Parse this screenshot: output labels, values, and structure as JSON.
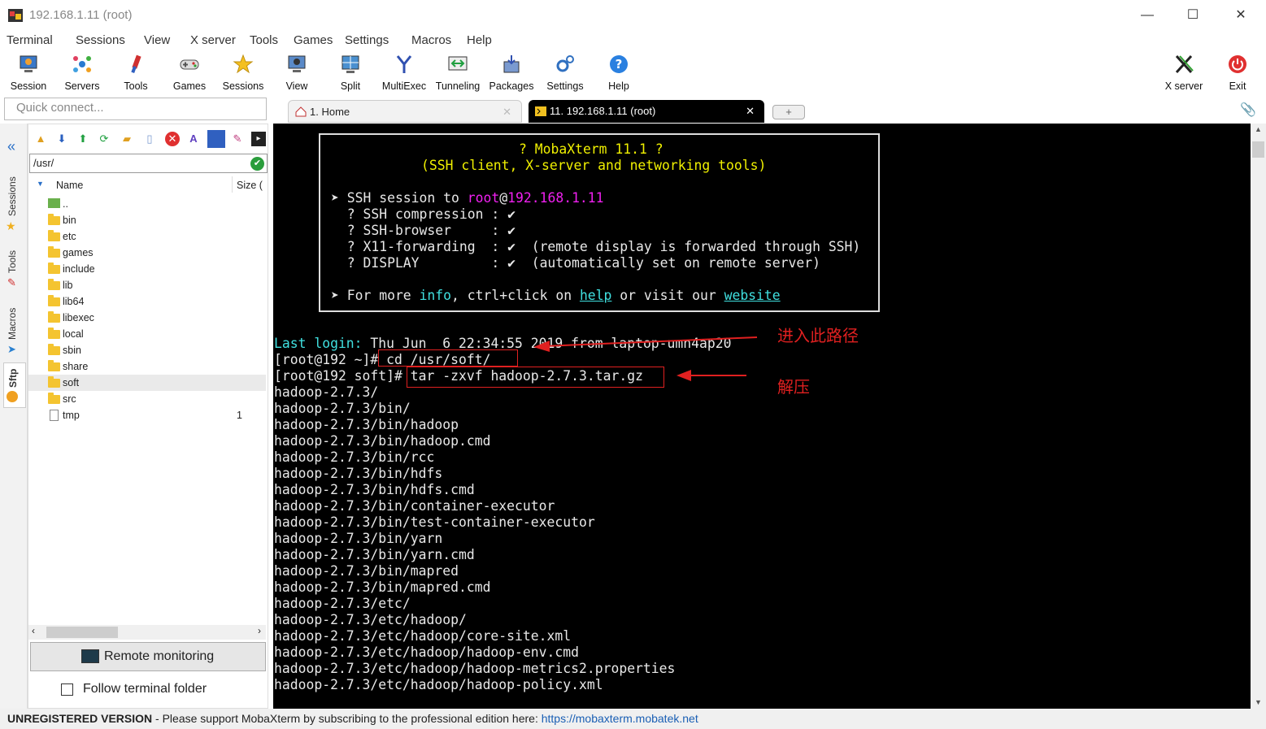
{
  "window": {
    "title": "192.168.1.11 (root)",
    "minimize": "—",
    "maximize": "☐",
    "close": "✕"
  },
  "menu": [
    "Terminal",
    "Sessions",
    "View",
    "X server",
    "Tools",
    "Games",
    "Settings",
    "Macros",
    "Help"
  ],
  "toolbar": {
    "session": "Session",
    "servers": "Servers",
    "tools": "Tools",
    "games": "Games",
    "sessions": "Sessions",
    "view": "View",
    "split": "Split",
    "multiexec": "MultiExec",
    "tunneling": "Tunneling",
    "packages": "Packages",
    "settings": "Settings",
    "help": "Help",
    "xserver": "X server",
    "exit": "Exit"
  },
  "quick_connect": {
    "placeholder": "Quick connect..."
  },
  "tabs": {
    "home": "1. Home",
    "ssh": "11. 192.168.1.11 (root)",
    "close": "✕",
    "add": "+"
  },
  "side_tabs": {
    "sessions": "Sessions",
    "tools": "Tools",
    "macros": "Macros",
    "sftp": "Sftp"
  },
  "sftp": {
    "path": "/usr/",
    "col_name": "Name",
    "col_size": "Size (",
    "files": [
      {
        "name": "..",
        "size": ""
      },
      {
        "name": "bin",
        "size": ""
      },
      {
        "name": "etc",
        "size": ""
      },
      {
        "name": "games",
        "size": ""
      },
      {
        "name": "include",
        "size": ""
      },
      {
        "name": "lib",
        "size": ""
      },
      {
        "name": "lib64",
        "size": ""
      },
      {
        "name": "libexec",
        "size": ""
      },
      {
        "name": "local",
        "size": ""
      },
      {
        "name": "sbin",
        "size": ""
      },
      {
        "name": "share",
        "size": ""
      },
      {
        "name": "soft",
        "size": ""
      },
      {
        "name": "src",
        "size": ""
      },
      {
        "name": "tmp",
        "size": "1"
      }
    ],
    "remote_monitoring": "Remote monitoring",
    "follow_folder": "Follow terminal folder"
  },
  "terminal": {
    "banner": {
      "title": "? MobaXterm 11.1 ?",
      "subtitle": "(SSH client, X-server and networking tools)",
      "ssh_prefix": "➤ SSH session to ",
      "user": "root",
      "at": "@",
      "host": "192.168.1.11",
      "compression": "  ? SSH compression : ✔",
      "browser": "  ? SSH-browser     : ✔",
      "x11": "  ? X11-forwarding  : ✔  (remote display is forwarded through SSH)",
      "display": "  ? DISPLAY         : ✔  (automatically set on remote server)",
      "more_prefix": "➤ For more ",
      "info": "info",
      "more_mid": ", ctrl+click on ",
      "help": "help",
      "more_mid2": " or visit our ",
      "website": "website"
    },
    "last_login_label": "Last login:",
    "last_login_value": " Thu Jun  6 22:34:55 2019 from laptop-umn4ap20",
    "prompt1": "[root@192 ~]#",
    "cmd1": " cd /usr/soft/",
    "prompt2": "[root@192 soft]#",
    "cmd2": " tar -zxvf hadoop-2.7.3.tar.gz",
    "output": [
      "hadoop-2.7.3/",
      "hadoop-2.7.3/bin/",
      "hadoop-2.7.3/bin/hadoop",
      "hadoop-2.7.3/bin/hadoop.cmd",
      "hadoop-2.7.3/bin/rcc",
      "hadoop-2.7.3/bin/hdfs",
      "hadoop-2.7.3/bin/hdfs.cmd",
      "hadoop-2.7.3/bin/container-executor",
      "hadoop-2.7.3/bin/test-container-executor",
      "hadoop-2.7.3/bin/yarn",
      "hadoop-2.7.3/bin/yarn.cmd",
      "hadoop-2.7.3/bin/mapred",
      "hadoop-2.7.3/bin/mapred.cmd",
      "hadoop-2.7.3/etc/",
      "hadoop-2.7.3/etc/hadoop/",
      "hadoop-2.7.3/etc/hadoop/core-site.xml",
      "hadoop-2.7.3/etc/hadoop/hadoop-env.cmd",
      "hadoop-2.7.3/etc/hadoop/hadoop-metrics2.properties",
      "hadoop-2.7.3/etc/hadoop/hadoop-policy.xml"
    ]
  },
  "annotations": {
    "enter_path": "进入此路径",
    "extract": "解压"
  },
  "status": {
    "unregistered": "UNREGISTERED VERSION",
    "message": "  -  Please support MobaXterm by subscribing to the professional edition here:  ",
    "url": "https://mobaxterm.mobatek.net"
  },
  "colors": {
    "annotation_red": "#e02020",
    "terminal_bg": "#000000",
    "prompt_green": "#40e020",
    "cyan": "#40e0e0",
    "magenta": "#f020f0",
    "yellow": "#f0f000"
  }
}
